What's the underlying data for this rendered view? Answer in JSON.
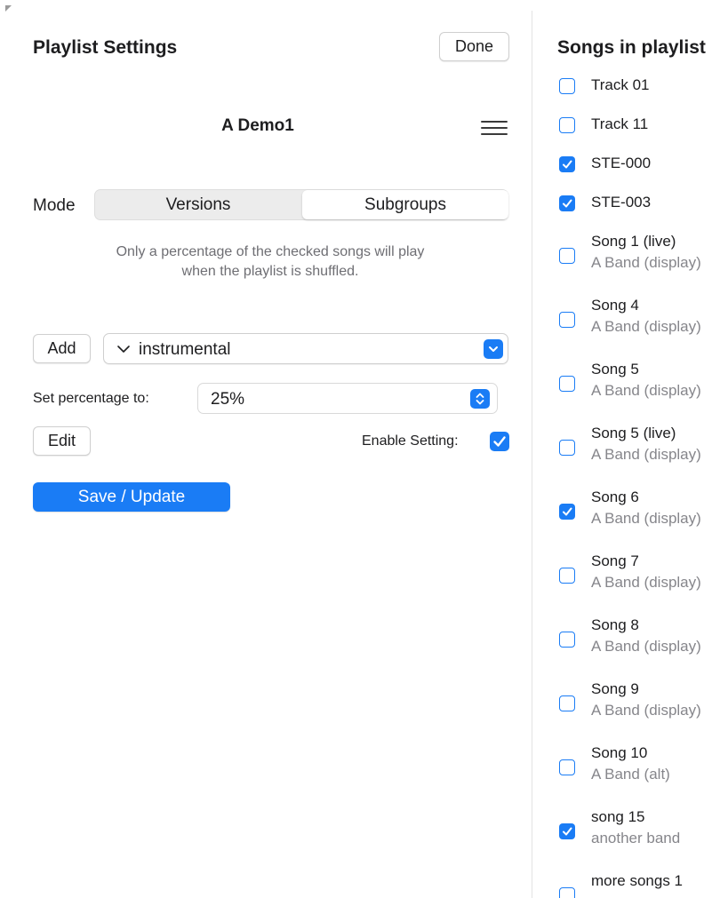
{
  "left": {
    "title": "Playlist Settings",
    "done_label": "Done",
    "playlist_name": "A Demo1",
    "menu_icon": "hamburger-icon",
    "mode_label": "Mode",
    "mode_options": [
      "Versions",
      "Subgroups"
    ],
    "mode_selected": "Subgroups",
    "info_line1": "Only a percentage of the checked songs will play",
    "info_line2": "when the playlist is shuffled.",
    "add_label": "Add",
    "subgroup_value": "instrumental",
    "percentage_label": "Set percentage to:",
    "percentage_value": "25%",
    "edit_label": "Edit",
    "enable_label": "Enable Setting:",
    "enable_checked": true,
    "save_label": "Save / Update"
  },
  "right": {
    "title": "Songs in playlist",
    "songs": [
      {
        "title": "Track 01",
        "artist": "",
        "checked": false
      },
      {
        "title": "Track 11",
        "artist": "",
        "checked": false
      },
      {
        "title": "STE-000",
        "artist": "",
        "checked": true
      },
      {
        "title": "STE-003",
        "artist": "",
        "checked": true
      },
      {
        "title": "Song 1 (live)",
        "artist": "A Band (display)",
        "checked": false
      },
      {
        "title": "Song 4",
        "artist": "A Band (display)",
        "checked": false
      },
      {
        "title": "Song 5",
        "artist": "A Band (display)",
        "checked": false
      },
      {
        "title": "Song 5 (live)",
        "artist": "A Band (display)",
        "checked": false
      },
      {
        "title": "Song 6",
        "artist": "A Band (display)",
        "checked": true
      },
      {
        "title": "Song 7",
        "artist": "A Band (display)",
        "checked": false
      },
      {
        "title": "Song 8",
        "artist": "A Band (display)",
        "checked": false
      },
      {
        "title": "Song 9",
        "artist": "A Band (display)",
        "checked": false
      },
      {
        "title": "Song 10",
        "artist": "A Band (alt)",
        "checked": false
      },
      {
        "title": "song 15",
        "artist": "another band",
        "checked": true
      },
      {
        "title": "more songs 1",
        "artist": "",
        "checked": false
      }
    ]
  },
  "colors": {
    "accent": "#1a7cf5",
    "secondary_text": "#86868b",
    "info_text": "#6e6e73"
  }
}
